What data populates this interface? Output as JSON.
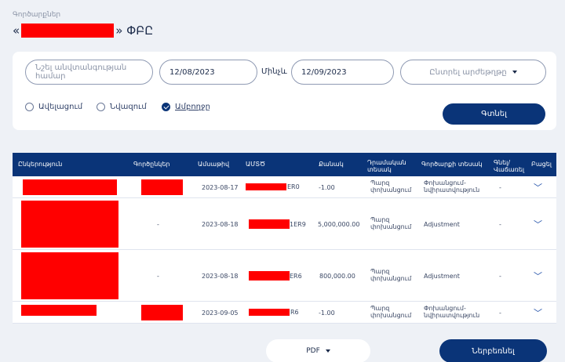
{
  "breadcrumb": "Գործարքներ",
  "title": {
    "open_quote": "«",
    "close_quote": "» ՓԲԸ"
  },
  "filters": {
    "account_placeholder": "Նշել անվտանգության համար",
    "date_from": "12/08/2023",
    "until_label": "Մինչև",
    "date_to": "12/09/2023",
    "currency_placeholder": "Ընտրել արժեթղթը",
    "radios": [
      "Ավելացում",
      "Նվազում",
      "Ամբողջը"
    ],
    "selected_radio": 2,
    "search_button": "Գտնել"
  },
  "table": {
    "headers": [
      "Ընկերություն",
      "Գործընկեր",
      "Ամսաթիվ",
      "ԱՄՏԾ",
      "Քանակ",
      "Դրամական\nտեսակ",
      "Գործարքի տեսակ",
      "Գնել/\nՎաճառել",
      "Բացել"
    ],
    "rows": [
      {
        "date": "2023-08-17",
        "isin_tail": "ER0",
        "quantity": "-1.00",
        "cash_type": "Պարզ\nփոխանցում",
        "txn_type": "Փոխանցում-\nնվիրատվություն",
        "buy_sell": "-"
      },
      {
        "partner": "-",
        "date": "2023-08-18",
        "isin_tail": "1ER9",
        "quantity": "5,000,000.00",
        "cash_type": "Պարզ\nփոխանցում",
        "txn_type": "Adjustment",
        "buy_sell": "-"
      },
      {
        "partner": "-",
        "date": "2023-08-18",
        "isin_tail": "ER6",
        "quantity": "800,000.00",
        "cash_type": "Պարզ\nփոխանցում",
        "txn_type": "Adjustment",
        "buy_sell": "-"
      },
      {
        "date": "2023-09-05",
        "isin_tail": "R6",
        "quantity": "-1.00",
        "cash_type": "Պարզ\nփոխանցում",
        "txn_type": "Փոխանցում-\nնվիրատվություն",
        "buy_sell": "-"
      }
    ]
  },
  "footer": {
    "format": "PDF",
    "download_button": "Ներբեռնել"
  }
}
